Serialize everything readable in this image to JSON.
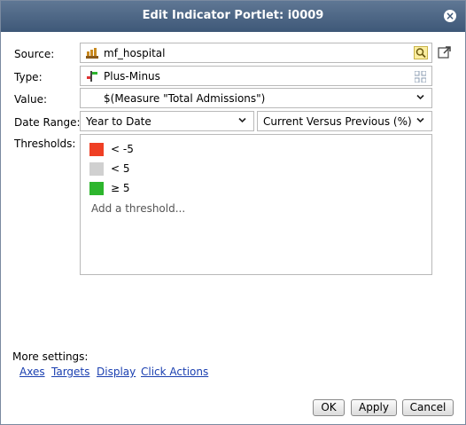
{
  "dialog": {
    "title": "Edit Indicator Portlet: i0009"
  },
  "source": {
    "label": "Source:",
    "value": "mf_hospital"
  },
  "type": {
    "label": "Type:",
    "value": "Plus-Minus"
  },
  "value": {
    "label": "Value:",
    "value": "$(Measure \"Total Admissions\")"
  },
  "date_range": {
    "label": "Date Range:",
    "period": "Year to Date",
    "comparison": "Current Versus Previous (%)"
  },
  "thresholds": {
    "label": "Thresholds:",
    "items": [
      {
        "text": "< -5",
        "color": "#ef3f24"
      },
      {
        "text": "< 5",
        "color": "#d0d0d0"
      },
      {
        "text": "≥ 5",
        "color": "#2db52d"
      }
    ],
    "add_label": "Add a threshold..."
  },
  "more_settings": {
    "label": "More settings:",
    "links": [
      "Axes",
      "Targets",
      "Display",
      "Click Actions"
    ]
  },
  "buttons": {
    "ok": "OK",
    "apply": "Apply",
    "cancel": "Cancel"
  }
}
